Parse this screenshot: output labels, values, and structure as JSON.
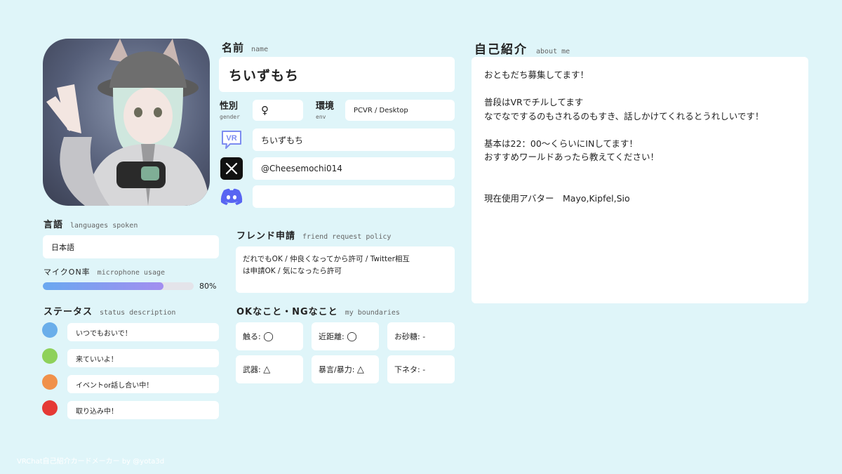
{
  "name": {
    "title": "名前",
    "sub": "name",
    "value": "ちいずもち"
  },
  "gender": {
    "title": "性別",
    "sub": "gender",
    "value": "♀"
  },
  "env": {
    "title": "環境",
    "sub": "env",
    "value": "PCVR / Desktop"
  },
  "accounts": {
    "vrchat": "ちいずもち",
    "x": "@Cheesemochi014",
    "discord": "",
    "vr_badge": "VR"
  },
  "languages": {
    "title": "言語",
    "sub": "languages spoken",
    "value": "日本語"
  },
  "mic": {
    "title": "マイクON率",
    "sub": "microphone usage",
    "percent": 80,
    "percent_label": "80%"
  },
  "status": {
    "title": "ステータス",
    "sub": "status description",
    "items": [
      {
        "color": "#6aaeea",
        "label": "いつでもおいで！"
      },
      {
        "color": "#8ed15a",
        "label": "来ていいよ！"
      },
      {
        "color": "#f0914a",
        "label": "イベントor話し合い中！"
      },
      {
        "color": "#e53935",
        "label": "取り込み中！"
      }
    ]
  },
  "friend": {
    "title": "フレンド申請",
    "sub": "friend request policy",
    "line1": "だれでもOK / 仲良くなってから許可 / Twitter相互",
    "line2": "は申請OK / 気になったら許可"
  },
  "boundaries": {
    "title": "OKなこと・NGなこと",
    "sub": "my boundaries",
    "items": [
      {
        "label": "触る:",
        "value": "◯"
      },
      {
        "label": "近距離:",
        "value": "◯"
      },
      {
        "label": "お砂糖:",
        "value": "-"
      },
      {
        "label": "武器:",
        "value": "△"
      },
      {
        "label": "暴言/暴力:",
        "value": "△"
      },
      {
        "label": "下ネタ:",
        "value": "-"
      }
    ]
  },
  "about": {
    "title": "自己紹介",
    "sub": "about me",
    "lines": [
      "おともだち募集してます！",
      "",
      "普段はVRでチルしてます",
      "なでなでするのもされるのもすき、話しかけてくれるとうれしいです！",
      "",
      "基本は22：00～くらいにINしてます！",
      "おすすめワールドあったら教えてください！",
      "",
      "",
      "現在使用アバター　Mayo,Kipfel,Sio"
    ]
  },
  "footer": "VRChat自己紹介カードメーカー by @yota3d",
  "colors": {
    "background": "#dff5f9",
    "bar_start": "#6aa8f0",
    "bar_end": "#a38ef0",
    "bar_track": "#e4e4ea",
    "vr_icon": "#7d8cf0",
    "discord": "#5865f2"
  }
}
